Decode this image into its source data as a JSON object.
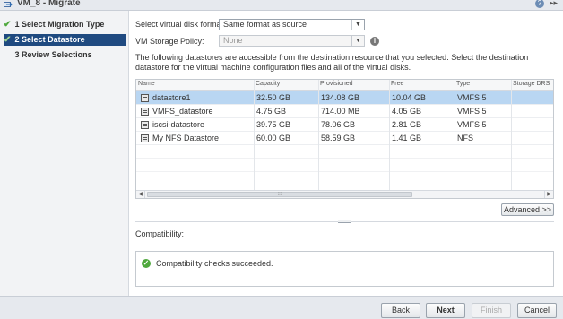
{
  "window": {
    "title": "VM_8 - Migrate",
    "help_glyph": "?",
    "expand_glyph": "▸▸"
  },
  "sidebar": {
    "steps": [
      {
        "num": "1",
        "label": "Select Migration Type",
        "done": true
      },
      {
        "num": "2",
        "label": "Select Datastore",
        "done": true,
        "active": true
      },
      {
        "num": "3",
        "label": "Review Selections",
        "done": false
      }
    ]
  },
  "form": {
    "disk_format_label": "Select virtual disk format:",
    "disk_format_value": "Same format as source",
    "storage_policy_label": "VM Storage Policy:",
    "storage_policy_value": "None",
    "description": "The following datastores are accessible from the destination resource that you selected. Select the destination datastore for the virtual machine configuration files and all of the virtual disks."
  },
  "table": {
    "columns": [
      "Name",
      "Capacity",
      "Provisioned",
      "Free",
      "Type",
      "Storage DRS"
    ],
    "rows": [
      {
        "name": "datastore1",
        "capacity": "32.50 GB",
        "provisioned": "134.08 GB",
        "free": "10.04 GB",
        "type": "VMFS 5",
        "drs": ""
      },
      {
        "name": "VMFS_datastore",
        "capacity": "4.75 GB",
        "provisioned": "714.00 MB",
        "free": "4.05 GB",
        "type": "VMFS 5",
        "drs": ""
      },
      {
        "name": "iscsi-datastore",
        "capacity": "39.75 GB",
        "provisioned": "78.06 GB",
        "free": "2.81 GB",
        "type": "VMFS 5",
        "drs": ""
      },
      {
        "name": "My NFS Datastore",
        "capacity": "60.00 GB",
        "provisioned": "58.59 GB",
        "free": "1.41 GB",
        "type": "NFS",
        "drs": ""
      }
    ],
    "selected_row": 0
  },
  "advanced_label": "Advanced >>",
  "compatibility": {
    "label": "Compatibility:",
    "message": "Compatibility checks succeeded."
  },
  "footer": {
    "back": "Back",
    "next": "Next",
    "finish": "Finish",
    "cancel": "Cancel"
  },
  "colors": {
    "accent": "#1f4a80",
    "selected_row": "#b9d6f2",
    "success": "#4fa83d"
  }
}
